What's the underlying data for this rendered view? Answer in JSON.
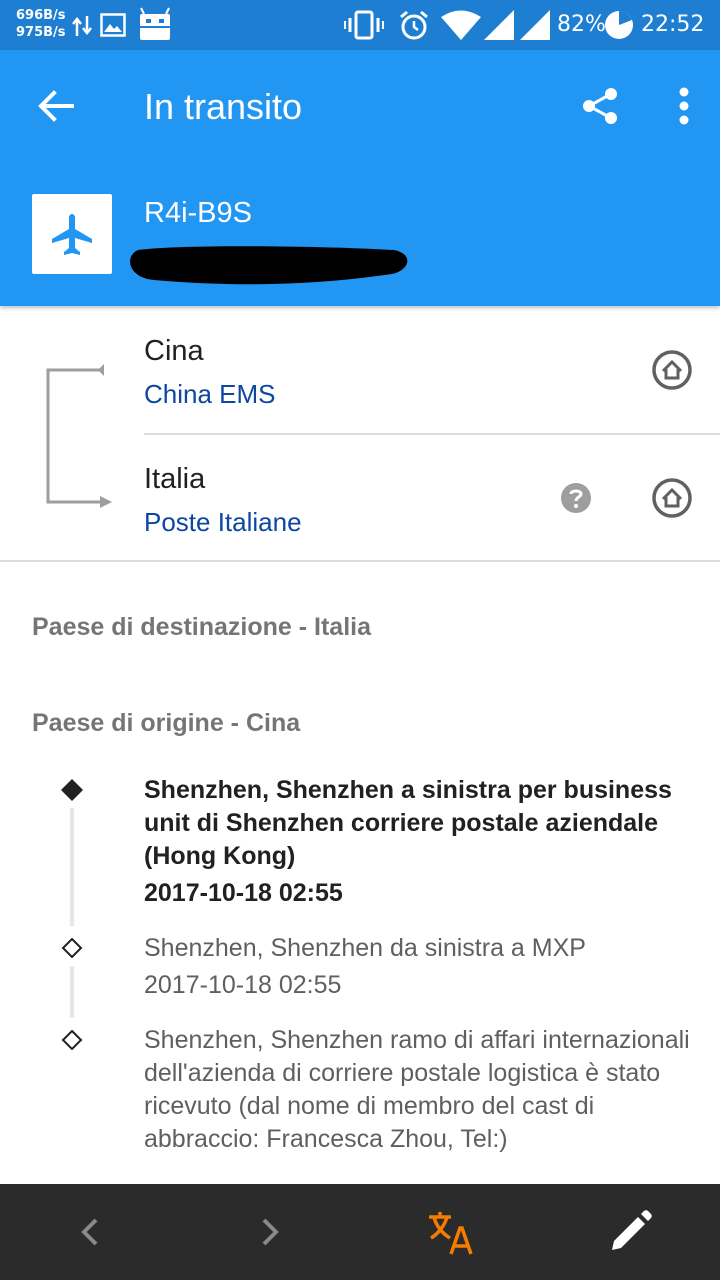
{
  "status_bar": {
    "net_up": "696B/s",
    "net_down": "975B/s",
    "battery": "82%",
    "time": "22:52",
    "icons": [
      "data-transfer-icon",
      "image-icon",
      "android-icon",
      "vibrate-icon",
      "alarm-icon",
      "wifi-icon",
      "signal-icon",
      "signal-icon",
      "battery-icon"
    ]
  },
  "app_bar": {
    "title": "In transito",
    "tracking_code": "R4i-B9S",
    "colors": {
      "primary": "#2196f3",
      "status": "#1e7fd2"
    }
  },
  "route": {
    "origin": {
      "country": "Cina",
      "carrier": "China EMS"
    },
    "destination": {
      "country": "Italia",
      "carrier": "Poste Italiane"
    }
  },
  "sections": {
    "destination_header": "Paese di destinazione - Italia",
    "origin_header": "Paese di origine - Cina"
  },
  "events": [
    {
      "text": "Shenzhen, Shenzhen a sinistra per business unit di Shenzhen corriere postale aziendale (Hong Kong)",
      "date": "2017-10-18 02:55"
    },
    {
      "text": "Shenzhen, Shenzhen da sinistra a MXP",
      "date": "2017-10-18 02:55"
    },
    {
      "text": "Shenzhen, Shenzhen ramo di affari internazionali dell'azienda di corriere postale logistica è stato ricevuto (dal nome di membro del cast di abbraccio: Francesca Zhou, Tel:)"
    }
  ],
  "bottom_bar": {
    "icons": [
      "chevron-left-icon",
      "chevron-right-icon",
      "translate-icon",
      "edit-icon"
    ],
    "accent": "#f57c00"
  }
}
